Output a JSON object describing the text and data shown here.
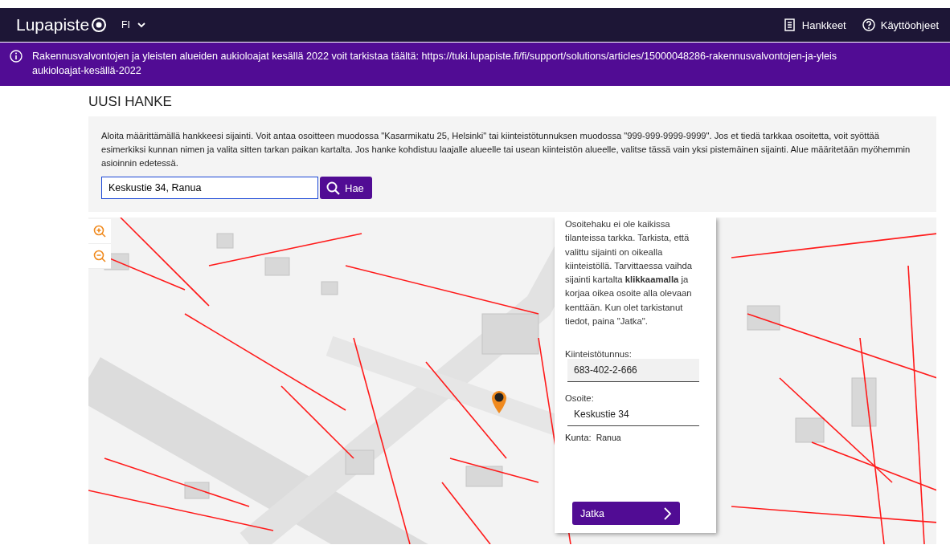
{
  "header": {
    "logo": "Lupapiste",
    "language": "FI",
    "links": [
      {
        "kind": "projects",
        "label": "Hankkeet"
      },
      {
        "kind": "help",
        "label": "Käyttöohjeet"
      }
    ]
  },
  "notice": {
    "line_1": "Rakennusvalvontojen ja yleisten alueiden aukioloajat kesällä 2022 voit tarkistaa täältä: https://tuki.lupapiste.fi/fi/support/solutions/articles/15000048286-rakennusvalvontojen-ja-yleis",
    "line_2": "aukioloajat-kesällä-2022"
  },
  "page_title": "UUSI HANKE",
  "intro": "Aloita määrittämällä hankkeesi sijainti. Voit antaa osoitteen muodossa \"Kasarmikatu 25, Helsinki\" tai kiinteistötunnuksen muodossa \"999-999-9999-9999\". Jos et tiedä tarkkaa osoitetta, voit syöttää esimerkiksi kunnan nimen ja valita sitten tarkan paikan kartalta. Jos hanke kohdistuu laajalle alueelle tai usean kiinteistön alueelle, valitse tässä vain yksi pistemäinen sijainti. Alue määritetään myöhemmin asioinnin edetessä.",
  "search": {
    "value": "Keskustie 34, Ranua",
    "button": "Hae"
  },
  "popup": {
    "text": "Osoitehaku ei ole kaikissa tilanteissa tarkka. Tarkista, että valittu sijainti on oikealla kiinteistöllä. Tarvittaessa vaihda sijainti kartalta **klikkaamalla** ja korjaa oikea osoite alla olevaan kenttään. Kun olet tarkistanut tiedot, paina \"Jatka\".",
    "fields": [
      {
        "label": "Kiinteistötunnus:",
        "value": "683-402-2-666",
        "disabled": true
      },
      {
        "label": "Osoite:",
        "value": "Keskustie 34",
        "disabled": false
      }
    ],
    "municipality_label": "Kunta:",
    "municipality": "Ranua",
    "button": "Jatka"
  }
}
